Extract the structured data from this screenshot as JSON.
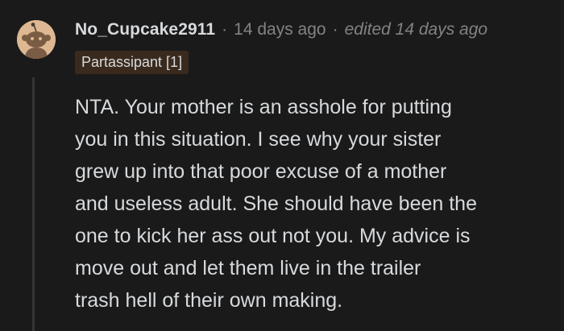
{
  "comment": {
    "author": "No_Cupcake2911",
    "separator": "·",
    "posted_ago": "14 days ago",
    "edited": "edited 14 days ago",
    "flair": "Partassipant [1]",
    "avatar_icon": "snoo-avatar-icon",
    "body_lines": [
      "NTA. Your mother is an asshole for putting",
      "you in this situation. I see why your sister",
      "grew up into that poor excuse of a mother",
      "and useless adult. She should have been the",
      "one to kick her ass out not you. My advice is",
      "move out and let them live in the trailer",
      "trash hell of their own making."
    ]
  },
  "colors": {
    "background": "#1a1a1b",
    "text": "#d7dadc",
    "meta": "#818384",
    "thread_line": "#343536",
    "flair_bg": "#3a2a1e",
    "avatar_bg": "#ddb892"
  }
}
